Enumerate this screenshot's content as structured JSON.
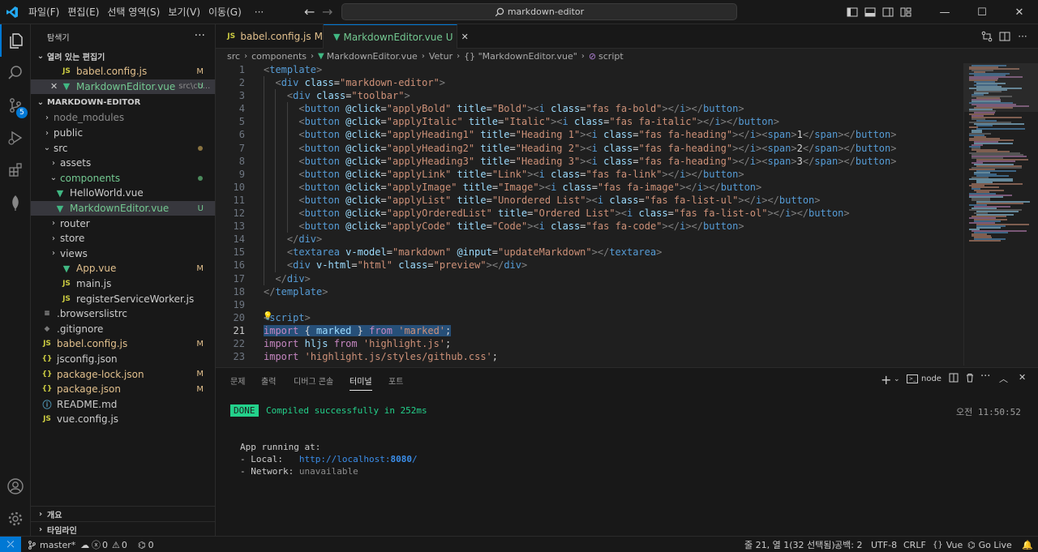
{
  "titlebar": {
    "menus": [
      "파일(F)",
      "편집(E)",
      "선택 영역(S)",
      "보기(V)",
      "이동(G)",
      "···"
    ],
    "search": "markdown-editor",
    "window": {
      "minimize": "—",
      "maximize": "☐",
      "close": "✕"
    }
  },
  "sidebar": {
    "title": "탐색기",
    "more": "···",
    "open_editors": {
      "heading": "열려 있는 편집기",
      "items": [
        {
          "name": "babel.config.js",
          "status": "M"
        },
        {
          "name": "MarkdownEditor.vue",
          "path": "src\\co...",
          "status": "U"
        }
      ]
    },
    "project": {
      "heading": "MARKDOWN-EDITOR",
      "items": [
        {
          "name": "node_modules"
        },
        {
          "name": "public"
        },
        {
          "name": "src"
        },
        {
          "name": "assets"
        },
        {
          "name": "components"
        },
        {
          "name": "HelloWorld.vue"
        },
        {
          "name": "MarkdownEditor.vue",
          "status": "U"
        },
        {
          "name": "router"
        },
        {
          "name": "store"
        },
        {
          "name": "views"
        },
        {
          "name": "App.vue",
          "status": "M"
        },
        {
          "name": "main.js"
        },
        {
          "name": "registerServiceWorker.js"
        },
        {
          "name": ".browserslistrc"
        },
        {
          "name": ".gitignore"
        },
        {
          "name": "babel.config.js",
          "status": "M"
        },
        {
          "name": "jsconfig.json"
        },
        {
          "name": "package-lock.json",
          "status": "M"
        },
        {
          "name": "package.json",
          "status": "M"
        },
        {
          "name": "README.md"
        },
        {
          "name": "vue.config.js"
        }
      ]
    },
    "outline": "개요",
    "timeline": "타임라인"
  },
  "tabs": [
    {
      "name": "babel.config.js",
      "status": "M"
    },
    {
      "name": "MarkdownEditor.vue",
      "status": "U"
    }
  ],
  "breadcrumb": [
    "src",
    "components",
    "MarkdownEditor.vue",
    "Vetur",
    "{} \"MarkdownEditor.vue\"",
    "script"
  ],
  "editor": {
    "current_line": 21,
    "lines": [
      [
        [
          "t-punc",
          "<"
        ],
        [
          "t-tag",
          "template"
        ],
        [
          "t-punc",
          ">"
        ]
      ],
      [
        [
          "",
          "  "
        ],
        [
          "t-punc",
          "<"
        ],
        [
          "t-tag",
          "div"
        ],
        [
          "t-attr",
          " class"
        ],
        [
          "t-text",
          "="
        ],
        [
          "t-str",
          "\"markdown-editor\""
        ],
        [
          "t-punc",
          ">"
        ]
      ],
      [
        [
          "",
          "    "
        ],
        [
          "t-punc",
          "<"
        ],
        [
          "t-tag",
          "div"
        ],
        [
          "t-attr",
          " class"
        ],
        [
          "t-text",
          "="
        ],
        [
          "t-str",
          "\"toolbar\""
        ],
        [
          "t-punc",
          ">"
        ]
      ],
      [
        [
          "",
          "      "
        ],
        [
          "t-punc",
          "<"
        ],
        [
          "t-tag",
          "button"
        ],
        [
          "t-attr",
          " @click"
        ],
        [
          "t-text",
          "="
        ],
        [
          "t-str",
          "\"applyBold\""
        ],
        [
          "t-attr",
          " title"
        ],
        [
          "t-text",
          "="
        ],
        [
          "t-str",
          "\"Bold\""
        ],
        [
          "t-punc",
          "><"
        ],
        [
          "t-tag",
          "i"
        ],
        [
          "t-attr",
          " class"
        ],
        [
          "t-text",
          "="
        ],
        [
          "t-str",
          "\"fas fa-bold\""
        ],
        [
          "t-punc",
          "></"
        ],
        [
          "t-tag",
          "i"
        ],
        [
          "t-punc",
          "></"
        ],
        [
          "t-tag",
          "button"
        ],
        [
          "t-punc",
          ">"
        ]
      ],
      [
        [
          "",
          "      "
        ],
        [
          "t-punc",
          "<"
        ],
        [
          "t-tag",
          "button"
        ],
        [
          "t-attr",
          " @click"
        ],
        [
          "t-text",
          "="
        ],
        [
          "t-str",
          "\"applyItalic\""
        ],
        [
          "t-attr",
          " title"
        ],
        [
          "t-text",
          "="
        ],
        [
          "t-str",
          "\"Italic\""
        ],
        [
          "t-punc",
          "><"
        ],
        [
          "t-tag",
          "i"
        ],
        [
          "t-attr",
          " class"
        ],
        [
          "t-text",
          "="
        ],
        [
          "t-str",
          "\"fas fa-italic\""
        ],
        [
          "t-punc",
          "></"
        ],
        [
          "t-tag",
          "i"
        ],
        [
          "t-punc",
          "></"
        ],
        [
          "t-tag",
          "button"
        ],
        [
          "t-punc",
          ">"
        ]
      ],
      [
        [
          "",
          "      "
        ],
        [
          "t-punc",
          "<"
        ],
        [
          "t-tag",
          "button"
        ],
        [
          "t-attr",
          " @click"
        ],
        [
          "t-text",
          "="
        ],
        [
          "t-str",
          "\"applyHeading1\""
        ],
        [
          "t-attr",
          " title"
        ],
        [
          "t-text",
          "="
        ],
        [
          "t-str",
          "\"Heading 1\""
        ],
        [
          "t-punc",
          "><"
        ],
        [
          "t-tag",
          "i"
        ],
        [
          "t-attr",
          " class"
        ],
        [
          "t-text",
          "="
        ],
        [
          "t-str",
          "\"fas fa-heading\""
        ],
        [
          "t-punc",
          "></"
        ],
        [
          "t-tag",
          "i"
        ],
        [
          "t-punc",
          "><"
        ],
        [
          "t-tag",
          "span"
        ],
        [
          "t-punc",
          ">"
        ],
        [
          "t-text",
          "1"
        ],
        [
          "t-punc",
          "</"
        ],
        [
          "t-tag",
          "span"
        ],
        [
          "t-punc",
          "></"
        ],
        [
          "t-tag",
          "button"
        ],
        [
          "t-punc",
          ">"
        ]
      ],
      [
        [
          "",
          "      "
        ],
        [
          "t-punc",
          "<"
        ],
        [
          "t-tag",
          "button"
        ],
        [
          "t-attr",
          " @click"
        ],
        [
          "t-text",
          "="
        ],
        [
          "t-str",
          "\"applyHeading2\""
        ],
        [
          "t-attr",
          " title"
        ],
        [
          "t-text",
          "="
        ],
        [
          "t-str",
          "\"Heading 2\""
        ],
        [
          "t-punc",
          "><"
        ],
        [
          "t-tag",
          "i"
        ],
        [
          "t-attr",
          " class"
        ],
        [
          "t-text",
          "="
        ],
        [
          "t-str",
          "\"fas fa-heading\""
        ],
        [
          "t-punc",
          "></"
        ],
        [
          "t-tag",
          "i"
        ],
        [
          "t-punc",
          "><"
        ],
        [
          "t-tag",
          "span"
        ],
        [
          "t-punc",
          ">"
        ],
        [
          "t-text",
          "2"
        ],
        [
          "t-punc",
          "</"
        ],
        [
          "t-tag",
          "span"
        ],
        [
          "t-punc",
          "></"
        ],
        [
          "t-tag",
          "button"
        ],
        [
          "t-punc",
          ">"
        ]
      ],
      [
        [
          "",
          "      "
        ],
        [
          "t-punc",
          "<"
        ],
        [
          "t-tag",
          "button"
        ],
        [
          "t-attr",
          " @click"
        ],
        [
          "t-text",
          "="
        ],
        [
          "t-str",
          "\"applyHeading3\""
        ],
        [
          "t-attr",
          " title"
        ],
        [
          "t-text",
          "="
        ],
        [
          "t-str",
          "\"Heading 3\""
        ],
        [
          "t-punc",
          "><"
        ],
        [
          "t-tag",
          "i"
        ],
        [
          "t-attr",
          " class"
        ],
        [
          "t-text",
          "="
        ],
        [
          "t-str",
          "\"fas fa-heading\""
        ],
        [
          "t-punc",
          "></"
        ],
        [
          "t-tag",
          "i"
        ],
        [
          "t-punc",
          "><"
        ],
        [
          "t-tag",
          "span"
        ],
        [
          "t-punc",
          ">"
        ],
        [
          "t-text",
          "3"
        ],
        [
          "t-punc",
          "</"
        ],
        [
          "t-tag",
          "span"
        ],
        [
          "t-punc",
          "></"
        ],
        [
          "t-tag",
          "button"
        ],
        [
          "t-punc",
          ">"
        ]
      ],
      [
        [
          "",
          "      "
        ],
        [
          "t-punc",
          "<"
        ],
        [
          "t-tag",
          "button"
        ],
        [
          "t-attr",
          " @click"
        ],
        [
          "t-text",
          "="
        ],
        [
          "t-str",
          "\"applyLink\""
        ],
        [
          "t-attr",
          " title"
        ],
        [
          "t-text",
          "="
        ],
        [
          "t-str",
          "\"Link\""
        ],
        [
          "t-punc",
          "><"
        ],
        [
          "t-tag",
          "i"
        ],
        [
          "t-attr",
          " class"
        ],
        [
          "t-text",
          "="
        ],
        [
          "t-str",
          "\"fas fa-link\""
        ],
        [
          "t-punc",
          "></"
        ],
        [
          "t-tag",
          "i"
        ],
        [
          "t-punc",
          "></"
        ],
        [
          "t-tag",
          "button"
        ],
        [
          "t-punc",
          ">"
        ]
      ],
      [
        [
          "",
          "      "
        ],
        [
          "t-punc",
          "<"
        ],
        [
          "t-tag",
          "button"
        ],
        [
          "t-attr",
          " @click"
        ],
        [
          "t-text",
          "="
        ],
        [
          "t-str",
          "\"applyImage\""
        ],
        [
          "t-attr",
          " title"
        ],
        [
          "t-text",
          "="
        ],
        [
          "t-str",
          "\"Image\""
        ],
        [
          "t-punc",
          "><"
        ],
        [
          "t-tag",
          "i"
        ],
        [
          "t-attr",
          " class"
        ],
        [
          "t-text",
          "="
        ],
        [
          "t-str",
          "\"fas fa-image\""
        ],
        [
          "t-punc",
          "></"
        ],
        [
          "t-tag",
          "i"
        ],
        [
          "t-punc",
          "></"
        ],
        [
          "t-tag",
          "button"
        ],
        [
          "t-punc",
          ">"
        ]
      ],
      [
        [
          "",
          "      "
        ],
        [
          "t-punc",
          "<"
        ],
        [
          "t-tag",
          "button"
        ],
        [
          "t-attr",
          " @click"
        ],
        [
          "t-text",
          "="
        ],
        [
          "t-str",
          "\"applyList\""
        ],
        [
          "t-attr",
          " title"
        ],
        [
          "t-text",
          "="
        ],
        [
          "t-str",
          "\"Unordered List\""
        ],
        [
          "t-punc",
          "><"
        ],
        [
          "t-tag",
          "i"
        ],
        [
          "t-attr",
          " class"
        ],
        [
          "t-text",
          "="
        ],
        [
          "t-str",
          "\"fas fa-list-ul\""
        ],
        [
          "t-punc",
          "></"
        ],
        [
          "t-tag",
          "i"
        ],
        [
          "t-punc",
          "></"
        ],
        [
          "t-tag",
          "button"
        ],
        [
          "t-punc",
          ">"
        ]
      ],
      [
        [
          "",
          "      "
        ],
        [
          "t-punc",
          "<"
        ],
        [
          "t-tag",
          "button"
        ],
        [
          "t-attr",
          " @click"
        ],
        [
          "t-text",
          "="
        ],
        [
          "t-str",
          "\"applyOrderedList\""
        ],
        [
          "t-attr",
          " title"
        ],
        [
          "t-text",
          "="
        ],
        [
          "t-str",
          "\"Ordered List\""
        ],
        [
          "t-punc",
          "><"
        ],
        [
          "t-tag",
          "i"
        ],
        [
          "t-attr",
          " class"
        ],
        [
          "t-text",
          "="
        ],
        [
          "t-str",
          "\"fas fa-list-ol\""
        ],
        [
          "t-punc",
          "></"
        ],
        [
          "t-tag",
          "i"
        ],
        [
          "t-punc",
          "></"
        ],
        [
          "t-tag",
          "button"
        ],
        [
          "t-punc",
          ">"
        ]
      ],
      [
        [
          "",
          "      "
        ],
        [
          "t-punc",
          "<"
        ],
        [
          "t-tag",
          "button"
        ],
        [
          "t-attr",
          " @click"
        ],
        [
          "t-text",
          "="
        ],
        [
          "t-str",
          "\"applyCode\""
        ],
        [
          "t-attr",
          " title"
        ],
        [
          "t-text",
          "="
        ],
        [
          "t-str",
          "\"Code\""
        ],
        [
          "t-punc",
          "><"
        ],
        [
          "t-tag",
          "i"
        ],
        [
          "t-attr",
          " class"
        ],
        [
          "t-text",
          "="
        ],
        [
          "t-str",
          "\"fas fa-code\""
        ],
        [
          "t-punc",
          "></"
        ],
        [
          "t-tag",
          "i"
        ],
        [
          "t-punc",
          "></"
        ],
        [
          "t-tag",
          "button"
        ],
        [
          "t-punc",
          ">"
        ]
      ],
      [
        [
          "",
          "    "
        ],
        [
          "t-punc",
          "</"
        ],
        [
          "t-tag",
          "div"
        ],
        [
          "t-punc",
          ">"
        ]
      ],
      [
        [
          "",
          "    "
        ],
        [
          "t-punc",
          "<"
        ],
        [
          "t-tag",
          "textarea"
        ],
        [
          "t-attr",
          " v-model"
        ],
        [
          "t-text",
          "="
        ],
        [
          "t-str",
          "\"markdown\""
        ],
        [
          "t-attr",
          " @input"
        ],
        [
          "t-text",
          "="
        ],
        [
          "t-str",
          "\"updateMarkdown\""
        ],
        [
          "t-punc",
          "></"
        ],
        [
          "t-tag",
          "textarea"
        ],
        [
          "t-punc",
          ">"
        ]
      ],
      [
        [
          "",
          "    "
        ],
        [
          "t-punc",
          "<"
        ],
        [
          "t-tag",
          "div"
        ],
        [
          "t-attr",
          " v-html"
        ],
        [
          "t-text",
          "="
        ],
        [
          "t-str",
          "\"html\""
        ],
        [
          "t-attr",
          " class"
        ],
        [
          "t-text",
          "="
        ],
        [
          "t-str",
          "\"preview\""
        ],
        [
          "t-punc",
          "></"
        ],
        [
          "t-tag",
          "div"
        ],
        [
          "t-punc",
          ">"
        ]
      ],
      [
        [
          "",
          "  "
        ],
        [
          "t-punc",
          "</"
        ],
        [
          "t-tag",
          "div"
        ],
        [
          "t-punc",
          ">"
        ]
      ],
      [
        [
          "t-punc",
          "</"
        ],
        [
          "t-tag",
          "template"
        ],
        [
          "t-punc",
          ">"
        ]
      ],
      [],
      [
        [
          "t-punc",
          "<"
        ],
        [
          "t-tag",
          "script"
        ],
        [
          "t-punc",
          ">"
        ]
      ],
      [
        [
          "t-kw",
          "import"
        ],
        [
          "t-text",
          " { "
        ],
        [
          "t-var",
          "marked"
        ],
        [
          "t-text",
          " } "
        ],
        [
          "t-kw",
          "from"
        ],
        [
          "t-text",
          " "
        ],
        [
          "t-str",
          "'marked'"
        ],
        [
          "t-text",
          ";"
        ]
      ],
      [
        [
          "t-kw",
          "import"
        ],
        [
          "t-text",
          " "
        ],
        [
          "t-var",
          "hljs"
        ],
        [
          "t-text",
          " "
        ],
        [
          "t-kw",
          "from"
        ],
        [
          "t-text",
          " "
        ],
        [
          "t-str",
          "'highlight.js'"
        ],
        [
          "t-text",
          ";"
        ]
      ],
      [
        [
          "t-kw",
          "import"
        ],
        [
          "t-text",
          " "
        ],
        [
          "t-str",
          "'highlight.js/styles/github.css'"
        ],
        [
          "t-text",
          ";"
        ]
      ]
    ]
  },
  "panel": {
    "tabs": [
      "문제",
      "출력",
      "디버그 콘솔",
      "터미널",
      "포트"
    ],
    "active_tab": "터미널",
    "terminal_name": "node",
    "done_badge": "DONE",
    "compiled": "Compiled successfully in 252ms",
    "time": "오전 11:50:52",
    "app_running": "App running at:",
    "local_label": "- Local:   ",
    "local_url_prefix": "http://localhost:",
    "local_port": "8080",
    "local_url_suffix": "/",
    "network_label": "- Network: ",
    "network_value": "unavailable"
  },
  "statusbar": {
    "branch": "master*",
    "errors": "0",
    "warnings": "0",
    "ports": "0",
    "position": "줄 21, 열 1(32 선택됨)",
    "spaces": "공백: 2",
    "encoding": "UTF-8",
    "eol": "CRLF",
    "language": "Vue",
    "golive": "Go Live"
  },
  "colors": {
    "accent": "#0078d4",
    "modified": "#e2c08d",
    "untracked": "#73c991",
    "done": "#23d18b"
  }
}
